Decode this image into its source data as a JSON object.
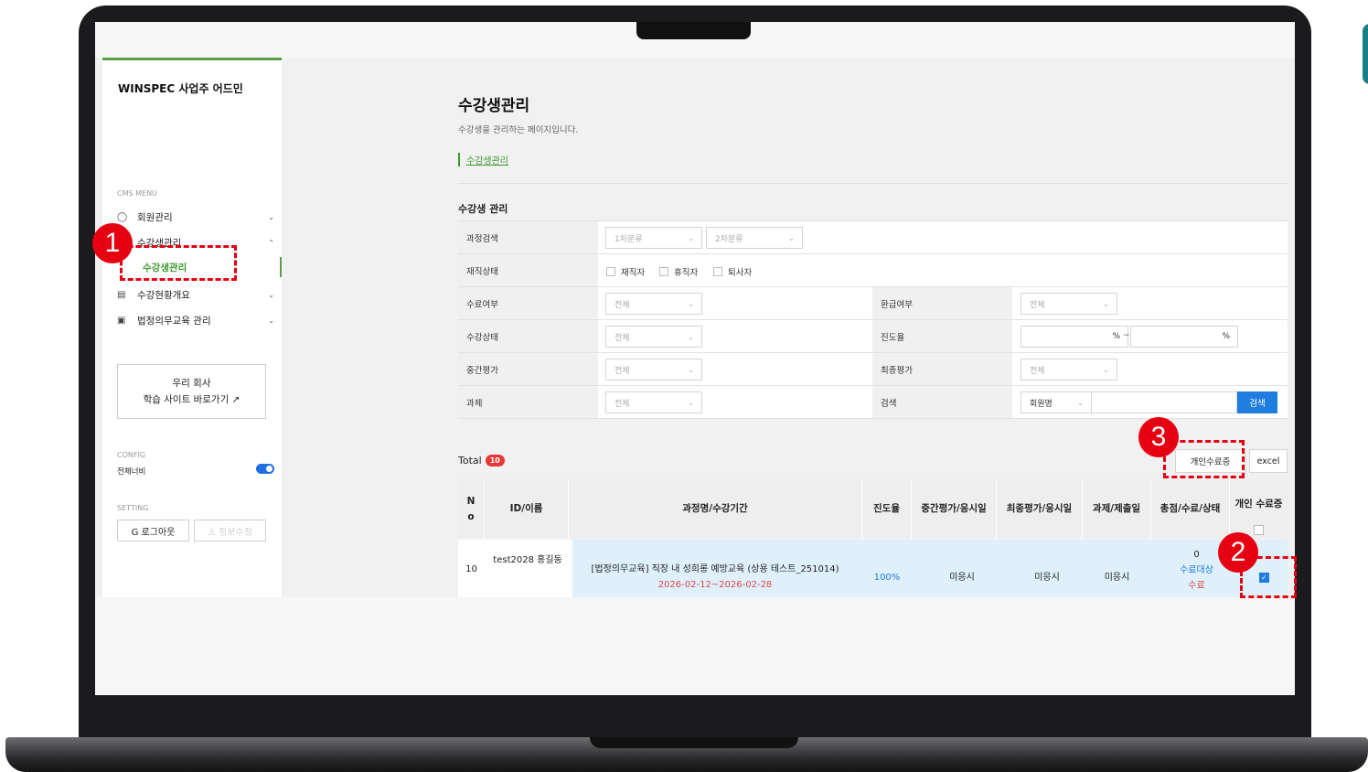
{
  "sidebar": {
    "brand": "WINSPEC 사업주 어드민",
    "cms_label": "CMS MENU",
    "menu": [
      {
        "icon": "member-icon",
        "label": "회원관리"
      },
      {
        "icon": "student-icon",
        "label": "수강생관리"
      },
      {
        "icon": "chart-icon",
        "label": "수강현황개요"
      },
      {
        "icon": "law-icon",
        "label": "법정의무교육 관리"
      }
    ],
    "submenu_active": "수강생관리",
    "shortcut_line1": "우리 회사",
    "shortcut_line2": "학습 사이트 바로가기 ↗",
    "config_label": "CONFIG",
    "config_item": "전체너비",
    "setting_label": "SETTING",
    "logout": "G 로그아웃",
    "edit_info": "♙ 정보수정"
  },
  "page": {
    "title": "수강생관리",
    "description": "수강생을 관리하는 페이지입니다.",
    "breadcrumb": "수강생관리",
    "section_title": "수강생 관리"
  },
  "filters": {
    "course_search": "과정검색",
    "category1": "1차분류",
    "category2": "2차분류",
    "employment_status": "재직상태",
    "employed": "재직자",
    "on_leave": "휴직자",
    "resigned": "퇴사자",
    "completion": "수료여부",
    "refund": "환급여부",
    "study_status": "수강상태",
    "progress": "진도율",
    "midterm": "중간평가",
    "final": "최종평가",
    "assignment": "과제",
    "search": "검색",
    "all": "전체",
    "percent": "%",
    "tilde": "~",
    "search_type": "회원명",
    "search_button": "검색"
  },
  "list": {
    "total_label": "Total",
    "total_count": "10",
    "personal_cert_button": "개인수료증",
    "excel_button": "excel",
    "headers": {
      "no": "N o",
      "id_name": "ID/이름",
      "course": "과정명/수강기간",
      "progress": "진도율",
      "midterm": "중간평가/응시일",
      "final": "최종평가/응시일",
      "assignment": "과제/제출일",
      "score": "총점/수료/상태",
      "cert": "개인 수료증"
    },
    "rows": [
      {
        "no": "10",
        "id_name": "test2028 홍길동",
        "course": "[법정의무교육] 직장 내 성희롱 예방교육 (상용 테스트_251014)",
        "period": "2026-02-12~2026-02-28",
        "progress": "100%",
        "midterm": "미응시",
        "final": "미응시",
        "assignment": "미응시",
        "score": "0",
        "completion": "수료대상",
        "status": "수료"
      }
    ]
  },
  "annotations": [
    "1",
    "2",
    "3"
  ],
  "colors": {
    "brand_green": "#3c9a2e",
    "accent_blue": "#1f7de0",
    "annotation_red": "#e50012"
  }
}
